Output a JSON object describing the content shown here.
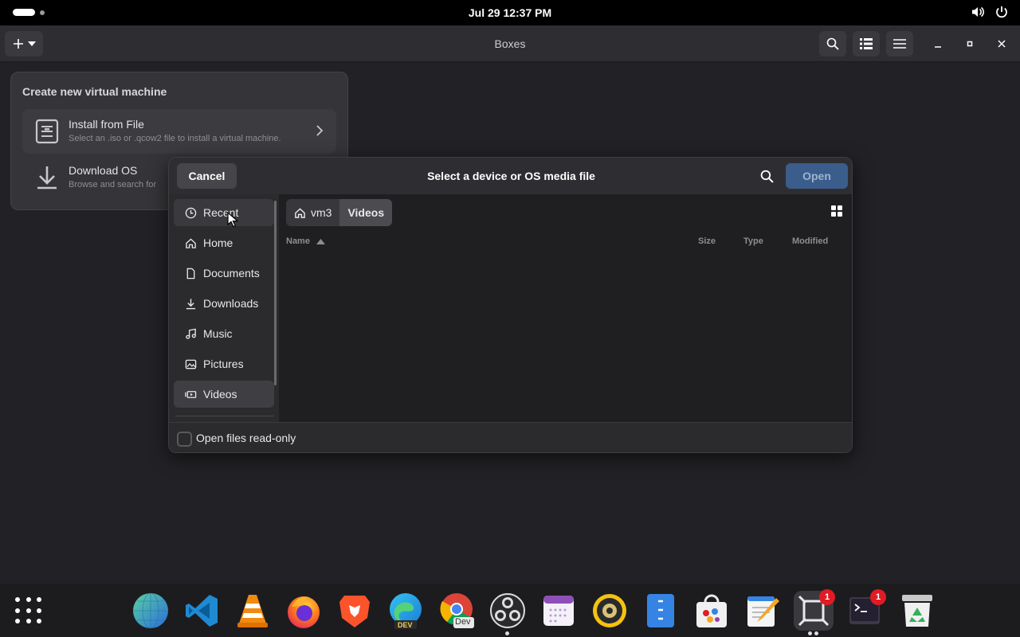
{
  "system_bar": {
    "clock": "Jul 29  12:37 PM"
  },
  "app": {
    "title": "Boxes"
  },
  "popover": {
    "title": "Create new virtual machine",
    "items": [
      {
        "title": "Install from File",
        "subtitle": "Select an .iso or .qcow2 file to install a virtual machine."
      },
      {
        "title": "Download OS",
        "subtitle": "Browse and search for"
      }
    ]
  },
  "dialog": {
    "cancel": "Cancel",
    "title": "Select a device or OS media file",
    "open": "Open",
    "sidebar": [
      {
        "label": "Recent",
        "icon": "clock-icon"
      },
      {
        "label": "Home",
        "icon": "home-icon"
      },
      {
        "label": "Documents",
        "icon": "document-icon"
      },
      {
        "label": "Downloads",
        "icon": "download-icon"
      },
      {
        "label": "Music",
        "icon": "music-icon"
      },
      {
        "label": "Pictures",
        "icon": "picture-icon"
      },
      {
        "label": "Videos",
        "icon": "video-icon"
      }
    ],
    "breadcrumb": [
      "vm3",
      "Videos"
    ],
    "columns": {
      "name": "Name",
      "size": "Size",
      "type": "Type",
      "modified": "Modified"
    },
    "readonly_label": "Open files read-only",
    "readonly_checked": false
  },
  "dock": {
    "apps": [
      {
        "name": "Globe",
        "icon": "globe-icon"
      },
      {
        "name": "Visual Studio Code",
        "icon": "vscode-icon"
      },
      {
        "name": "VLC",
        "icon": "vlc-icon"
      },
      {
        "name": "Firefox",
        "icon": "firefox-icon"
      },
      {
        "name": "Brave",
        "icon": "brave-icon"
      },
      {
        "name": "Edge Dev",
        "icon": "edge-dev-icon",
        "label": "DEV"
      },
      {
        "name": "Chrome Dev",
        "icon": "chrome-dev-icon",
        "label": "Dev"
      },
      {
        "name": "OBS Studio",
        "icon": "obs-icon"
      },
      {
        "name": "Calendar",
        "icon": "calendar-icon"
      },
      {
        "name": "Rhythmbox",
        "icon": "speaker-icon"
      },
      {
        "name": "Files",
        "icon": "archive-icon"
      },
      {
        "name": "Software",
        "icon": "store-icon"
      },
      {
        "name": "Text Editor",
        "icon": "text-editor-icon"
      },
      {
        "name": "Boxes",
        "icon": "boxes-icon",
        "badge": "1"
      },
      {
        "name": "Terminal",
        "icon": "terminal-icon",
        "badge": "1"
      },
      {
        "name": "Trash",
        "icon": "trash-icon"
      }
    ]
  },
  "colors": {
    "accent_blue": "#3a5d8c",
    "badge_red": "#e01b24",
    "window_bg": "#222226",
    "dialog_bg": "#2b2b2e"
  }
}
